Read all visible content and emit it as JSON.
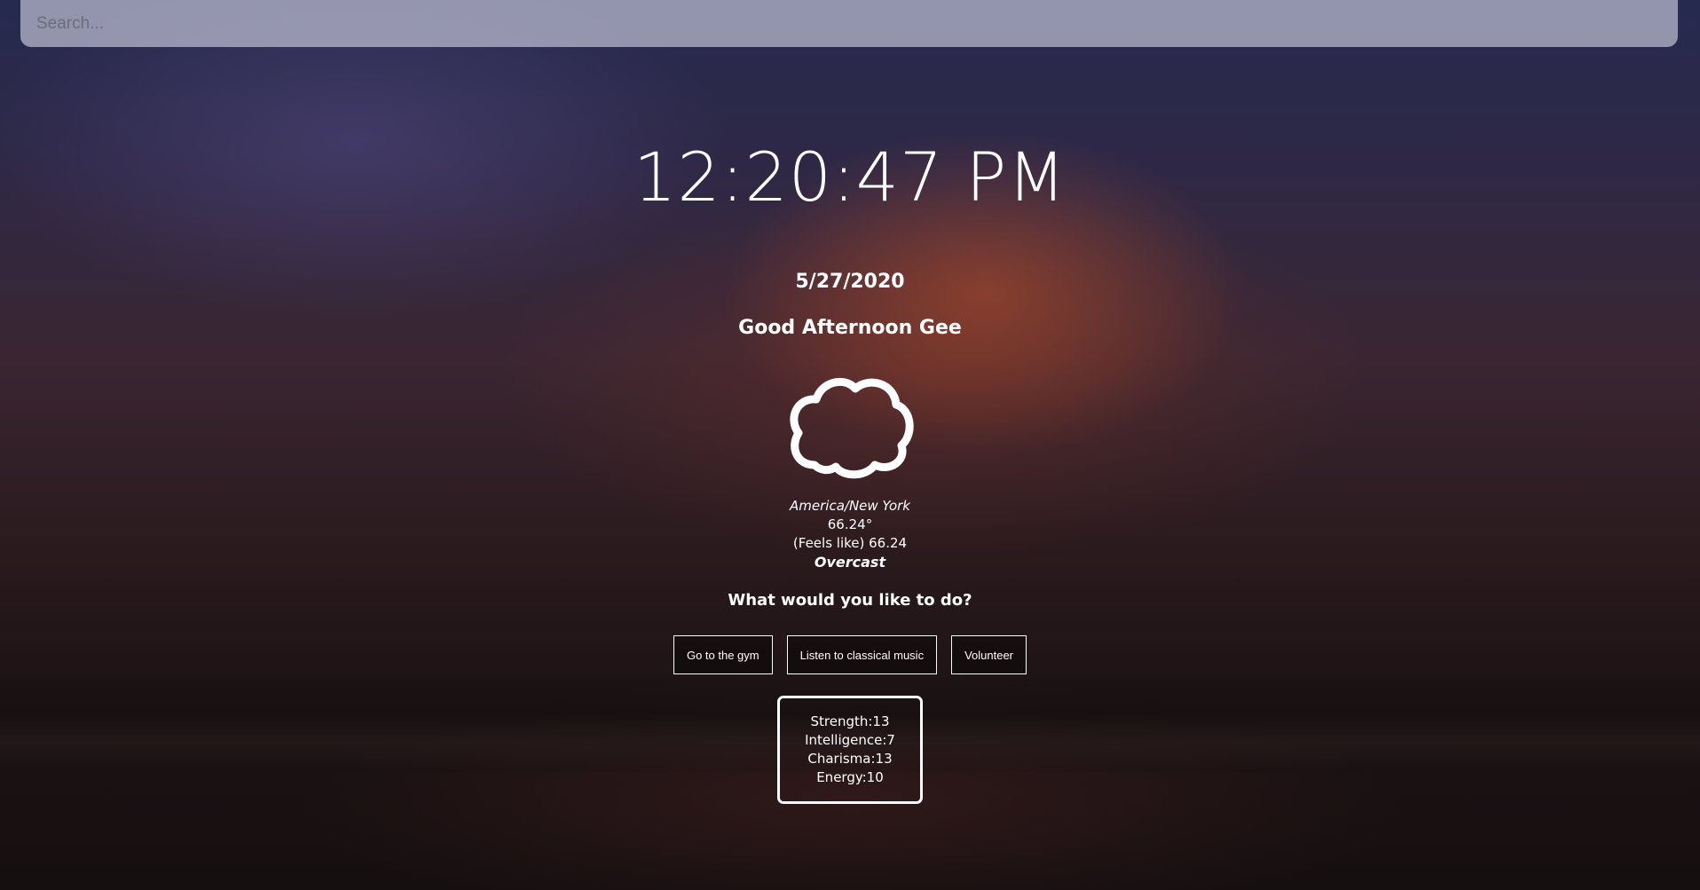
{
  "search": {
    "placeholder": "Search..."
  },
  "clock": {
    "time": "12:20:47 PM"
  },
  "date": "5/27/2020",
  "greeting": "Good Afternoon Gee",
  "weather": {
    "icon": "cloud-icon",
    "location": "America/New York",
    "temperature": "66.24°",
    "feels_like": "(Feels like) 66.24",
    "description": "Overcast"
  },
  "prompt": "What would you like to do?",
  "actions": [
    {
      "label": "Go to the gym"
    },
    {
      "label": "Listen to classical music"
    },
    {
      "label": "Volunteer"
    }
  ],
  "stats": {
    "strength": "Strength:13",
    "intelligence": "Intelligence:7",
    "charisma": "Charisma:13",
    "energy": "Energy:10"
  }
}
